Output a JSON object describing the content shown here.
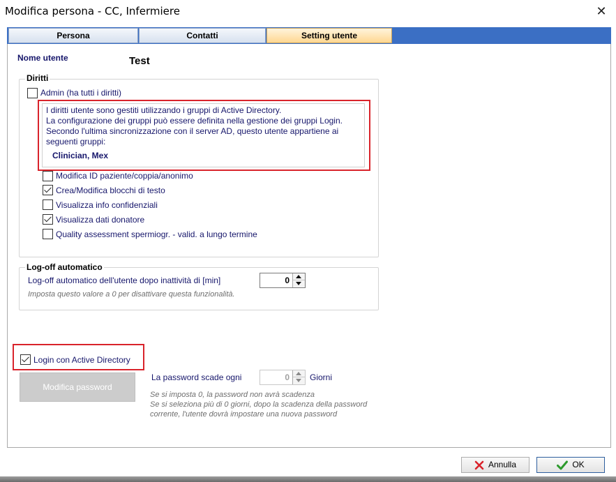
{
  "window": {
    "title": "Modifica persona - CC, Infermiere",
    "close_glyph": "✕"
  },
  "tabs": [
    {
      "label": "Persona"
    },
    {
      "label": "Contatti"
    },
    {
      "label": "Setting utente"
    }
  ],
  "user": {
    "label": "Nome utente",
    "value": "Test"
  },
  "rights": {
    "title": "Diritti",
    "admin_label": "Admin (ha tutti i diritti)",
    "admin_checked": false,
    "ad_info": {
      "line1": "I diritti utente sono gestiti utilizzando i gruppi di Active Directory.",
      "line2": "La configurazione dei gruppi può essere definita nella gestione dei gruppi Login.",
      "line3": "Secondo l'ultima sincronizzazione con il server AD, questo utente appartiene ai",
      "line4": "seguenti gruppi:",
      "groups": "Clinician, Mex"
    },
    "items": [
      {
        "label": "Modifica ID paziente/coppia/anonimo",
        "checked": false
      },
      {
        "label": "Crea/Modifica blocchi di testo",
        "checked": true
      },
      {
        "label": "Visualizza info confidenziali",
        "checked": false
      },
      {
        "label": "Visualizza dati donatore",
        "checked": true
      },
      {
        "label": "Quality assessment spermiogr. - valid. a lungo termine",
        "checked": false
      }
    ]
  },
  "logoff": {
    "title": "Log-off automatico",
    "label": "Log-off automatico dell'utente dopo inattività di [min]",
    "value": "0",
    "hint": "Imposta questo valore a 0 per disattivare questa funzionalità."
  },
  "ad_login": {
    "label": "Login con Active Directory",
    "checked": true
  },
  "password": {
    "button_label": "Modifica password",
    "expiry_label": "La password scade ogni",
    "expiry_value": "0",
    "unit": "Giorni",
    "hint1": "Se si imposta 0, la password non avrà scadenza",
    "hint2": "Se si seleziona più di 0 giorni, dopo la scadenza della password",
    "hint3": "corrente, l'utente dovrà impostare una nuova password"
  },
  "footer": {
    "cancel_label": "Annulla",
    "ok_label": "OK"
  },
  "colors": {
    "highlight_red": "#d9232b",
    "label_blue": "#16166b",
    "tab_active": "#ffd791",
    "tab_strip": "#3b6fc4"
  },
  "icons": {
    "cancel": "x-icon",
    "ok": "check-icon"
  }
}
